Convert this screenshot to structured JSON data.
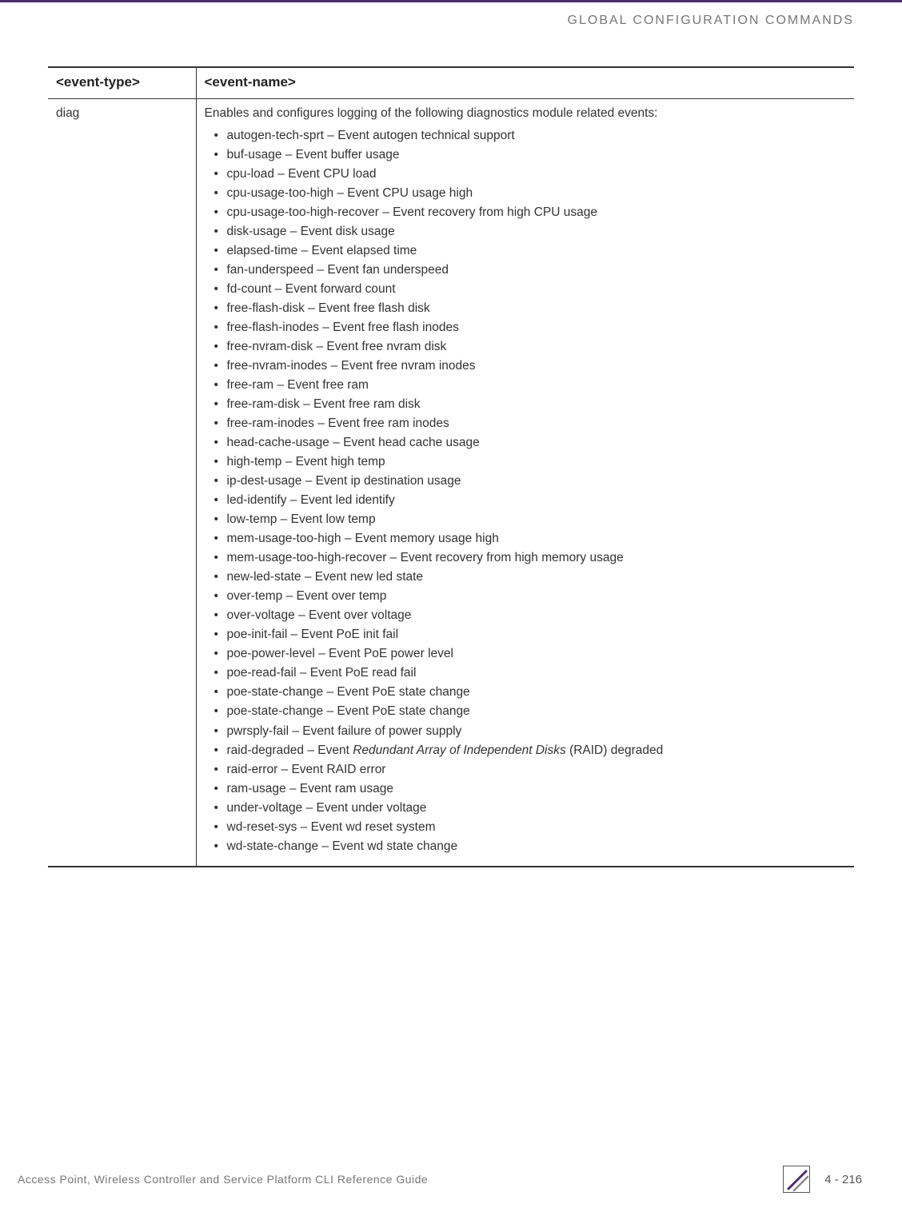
{
  "header": {
    "title": "GLOBAL CONFIGURATION COMMANDS"
  },
  "table": {
    "col1_header": "<event-type>",
    "col2_header": "<event-name>",
    "row1_col1": "diag",
    "row1_intro": "Enables and configures logging of the following diagnostics module related events:",
    "items": [
      "autogen-tech-sprt – Event autogen technical support",
      "buf-usage – Event buffer usage",
      "cpu-load – Event CPU load",
      "cpu-usage-too-high – Event CPU usage high",
      "cpu-usage-too-high-recover – Event recovery from high CPU usage",
      "disk-usage – Event disk usage",
      "elapsed-time – Event elapsed time",
      "fan-underspeed – Event fan underspeed",
      "fd-count – Event forward count",
      "free-flash-disk – Event free flash disk",
      "free-flash-inodes – Event free flash inodes",
      "free-nvram-disk – Event free nvram disk",
      "free-nvram-inodes – Event free nvram inodes",
      "free-ram – Event free ram",
      "free-ram-disk – Event free ram disk",
      "free-ram-inodes – Event free ram inodes",
      "head-cache-usage – Event head cache usage",
      "high-temp – Event high temp",
      "ip-dest-usage – Event ip destination usage",
      "led-identify – Event led identify",
      "low-temp – Event low temp",
      "mem-usage-too-high – Event memory usage high",
      "mem-usage-too-high-recover – Event recovery from high memory usage",
      "new-led-state – Event new led state",
      "over-temp – Event over temp",
      "over-voltage – Event over voltage",
      "poe-init-fail – Event PoE init fail",
      "poe-power-level – Event PoE power level",
      "poe-read-fail – Event PoE read fail",
      "poe-state-change – Event PoE state change",
      "poe-state-change – Event PoE state change",
      "pwrsply-fail – Event failure of power supply"
    ],
    "raid_prefix": "raid-degraded – Event ",
    "raid_italic": "Redundant Array of Independent Disks",
    "raid_suffix": " (RAID) degraded",
    "items_after": [
      "raid-error – Event RAID error",
      "ram-usage – Event ram usage",
      "under-voltage – Event under voltage",
      "wd-reset-sys – Event wd reset system",
      "wd-state-change – Event wd state change"
    ]
  },
  "footer": {
    "text": "Access Point, Wireless Controller and Service Platform CLI Reference Guide",
    "page": "4 - 216"
  }
}
